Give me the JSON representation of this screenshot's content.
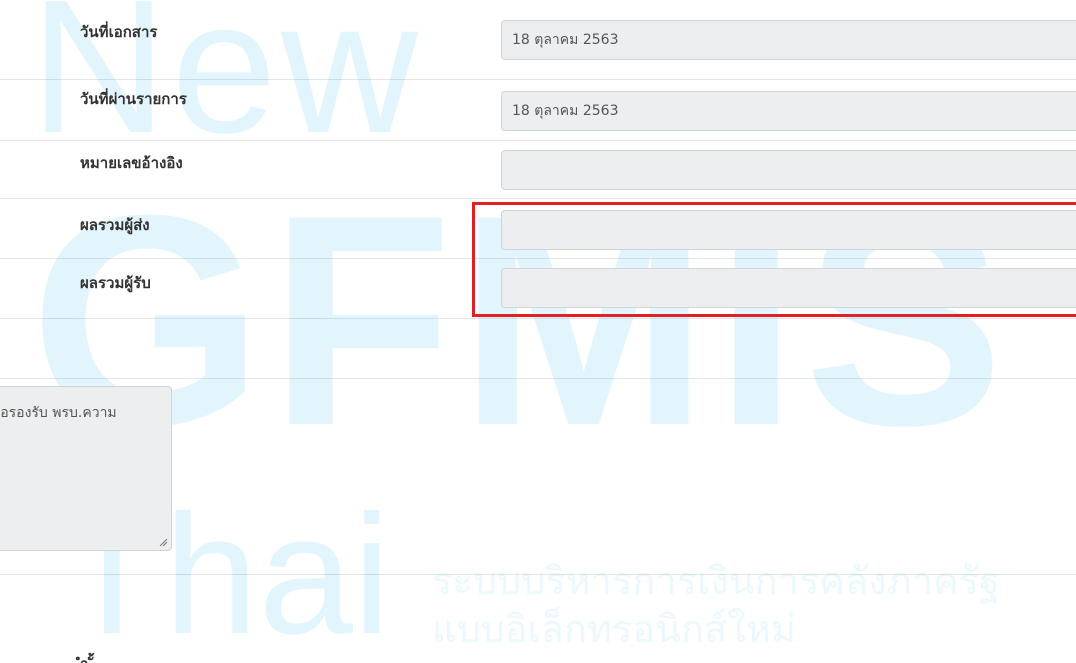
{
  "form": {
    "fields": [
      {
        "label": "วันที่เอกสาร",
        "value": "18 ตุลาคม 2563"
      },
      {
        "label": "วันที่ผ่านรายการ",
        "value": "18 ตุลาคม 2563"
      },
      {
        "label": "หมายเลขอ้างอิง",
        "value": ""
      },
      {
        "label": "ผลรวมผู้ส่ง",
        "value": ""
      },
      {
        "label": "ผลรวมผู้รับ",
        "value": ""
      }
    ],
    "remark_text": "พื่อรองรับ พรบ.ความ",
    "bottom_label_partial": "ำ            ั้"
  },
  "highlight": {
    "color": "#e31e24"
  },
  "watermark": {
    "line1": "New",
    "line2": "GFMIS",
    "line3": "Thai",
    "subtitle_line1": "ระบบบริหารการเงินการคลังภาครัฐ",
    "subtitle_line2": "แบบอิเล็กทรอนิกส์ใหม่"
  }
}
